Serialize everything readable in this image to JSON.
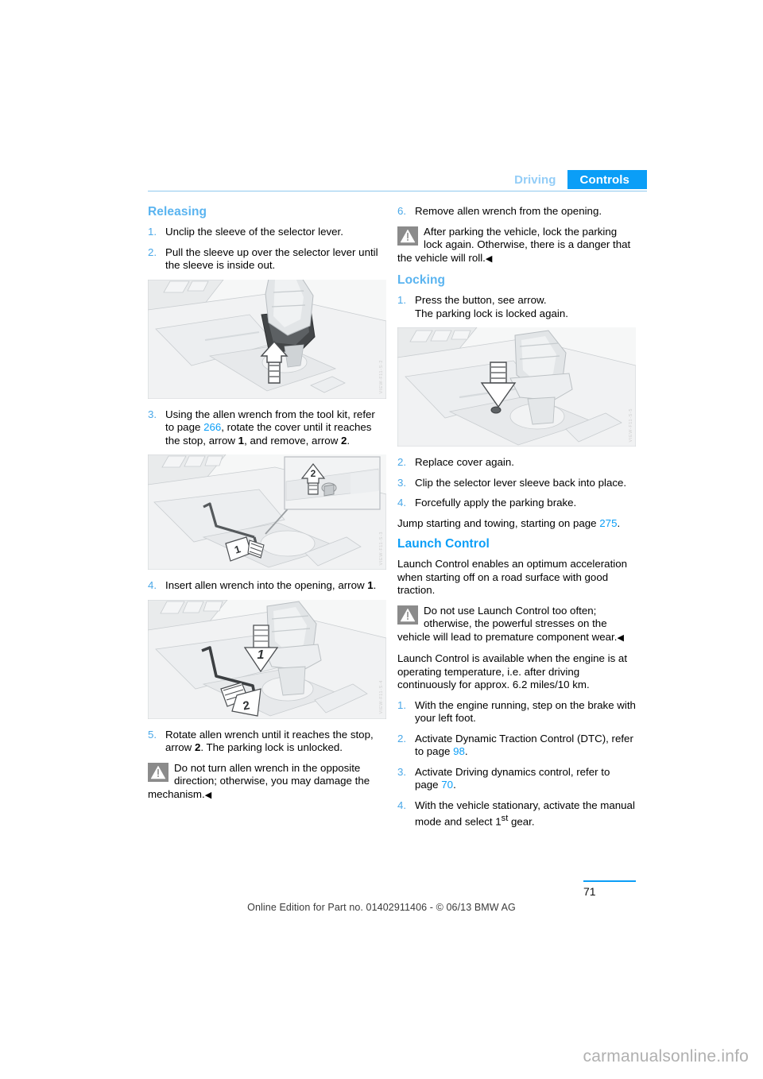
{
  "header": {
    "tab_inactive": "Driving",
    "tab_active": "Controls",
    "accent_color": "#0b9ef7",
    "inactive_color": "#93cdf7"
  },
  "left_column": {
    "heading": "Releasing",
    "steps": [
      {
        "num": "1.",
        "text": "Unclip the sleeve of the selector lever."
      },
      {
        "num": "2.",
        "text": "Pull the sleeve up over the selector lever until the sleeve is inside out."
      }
    ],
    "figure1": {
      "name": "selector-lever-sleeve-up-arrow",
      "watermark": "VIEW-F11-S-2"
    },
    "step3": {
      "num": "3.",
      "part1": "Using the allen wrench from the tool kit, refer to page ",
      "page_ref": "266",
      "part2": ", rotate the cover until it reaches the stop, arrow ",
      "arrow_a": "1",
      "part3": ", and remove, arrow ",
      "arrow_b": "2",
      "part4": "."
    },
    "figure2": {
      "name": "allen-wrench-rotate-cover",
      "inset_label": "2",
      "arrow_label": "1",
      "watermark": "VIEW-F11-S-3"
    },
    "step4": {
      "num": "4.",
      "part1": "Insert allen wrench into the opening, arrow ",
      "arrow_a": "1",
      "part2": "."
    },
    "figure3": {
      "name": "allen-wrench-insert-opening",
      "arrow_label_1": "1",
      "arrow_label_2": "2",
      "watermark": "VIEW-F11-S-4"
    },
    "step5": {
      "num": "5.",
      "text": "Rotate allen wrench until it reaches the stop, arrow ",
      "arrow_a": "2",
      "text2": ". The parking lock is unlocked."
    },
    "warning": {
      "icon": "warning-triangle-icon",
      "text": "Do not turn allen wrench in the opposite direction; otherwise, you may damage the mechanism.",
      "endmark": "◀"
    }
  },
  "right_column": {
    "step6": {
      "num": "6.",
      "text": "Remove allen wrench from the opening."
    },
    "warning_top": {
      "icon": "warning-triangle-icon",
      "text": "After parking the vehicle, lock the parking lock again. Otherwise, there is a danger that the vehicle will roll.",
      "endmark": "◀"
    },
    "locking_heading": "Locking",
    "locking_steps": [
      {
        "num": "1.",
        "text": "Press the button, see arrow.\nThe parking lock is locked again."
      }
    ],
    "figure4": {
      "name": "press-button-down-arrow",
      "watermark": "VIEW-F11-S-5"
    },
    "locking_steps_after": [
      {
        "num": "2.",
        "text": "Replace cover again."
      },
      {
        "num": "3.",
        "text": "Clip the selector lever sleeve back into place."
      },
      {
        "num": "4.",
        "text": "Forcefully apply the parking brake."
      }
    ],
    "jump_start": {
      "part1": "Jump starting and towing, starting on page ",
      "page_ref": "275",
      "part2": "."
    },
    "launch_heading": "Launch Control",
    "launch_intro": "Launch Control enables an optimum acceleration when starting off on a road surface with good traction.",
    "launch_warning": {
      "icon": "warning-triangle-icon",
      "text": "Do not use Launch Control too often; otherwise, the powerful stresses on the vehicle will lead to premature component wear.",
      "endmark": "◀"
    },
    "launch_avail": "Launch Control is available when the engine is at operating temperature, i.e. after driving continuously for approx. 6.2 miles/10 km.",
    "launch_steps": [
      {
        "num": "1.",
        "text": "With the engine running, step on the brake with your left foot."
      },
      {
        "num": "2.",
        "pre": "Activate Dynamic Traction Control (DTC), refer to page ",
        "page_ref": "98",
        "post": "."
      },
      {
        "num": "3.",
        "pre": "Activate Driving dynamics control, refer to page ",
        "page_ref": "70",
        "post": "."
      },
      {
        "num": "4.",
        "pre": "With the vehicle stationary, activate the manual mode and select 1",
        "sup": "st",
        "post": " gear."
      }
    ]
  },
  "footer": {
    "edition_note": "Online Edition for Part no. 01402911406 - © 06/13 BMW AG",
    "page_number": "71",
    "site_watermark": "carmanualsonline.info"
  }
}
